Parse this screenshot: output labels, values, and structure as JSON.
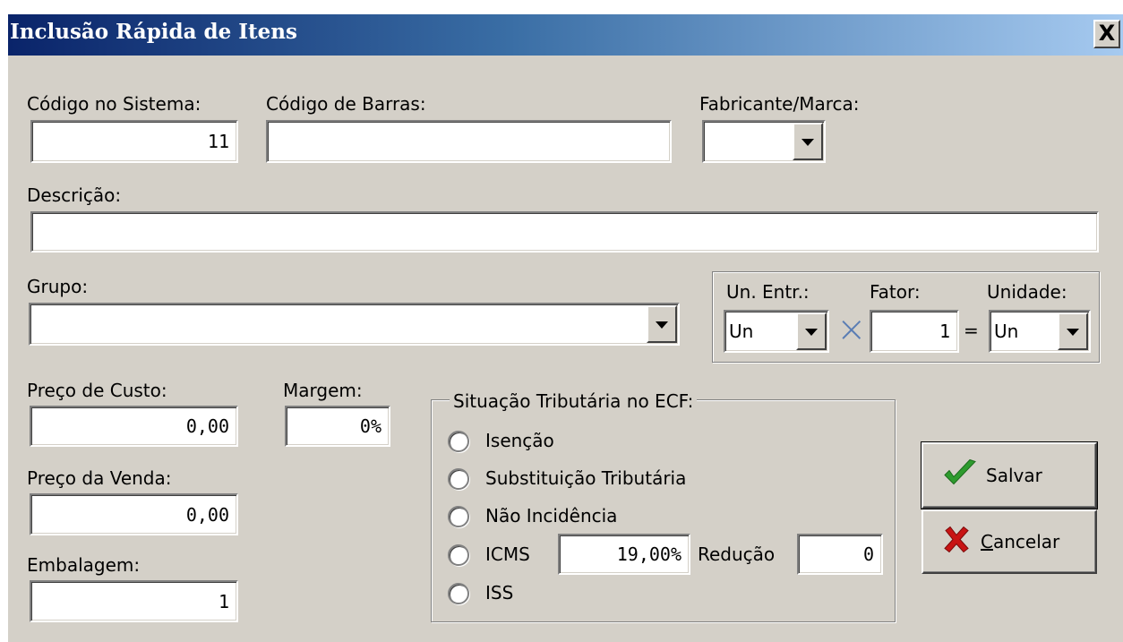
{
  "window": {
    "title": "Inclusão Rápida de Itens",
    "close_label": "X"
  },
  "codigo_sistema": {
    "label": "Código no Sistema:",
    "value": "11"
  },
  "codigo_barras": {
    "label": "Código de Barras:",
    "value": ""
  },
  "fabricante": {
    "label": "Fabricante/Marca:",
    "value": ""
  },
  "descricao": {
    "label": "Descrição:",
    "value": ""
  },
  "grupo": {
    "label": "Grupo:",
    "value": ""
  },
  "unidades": {
    "un_entr_label": "Un. Entr.:",
    "un_entr_value": "Un",
    "times_symbol": "×",
    "fator_label": "Fator:",
    "fator_value": "1",
    "equals_symbol": "=",
    "unidade_label": "Unidade:",
    "unidade_value": "Un"
  },
  "preco_custo": {
    "label": "Preço de Custo:",
    "value": "0,00"
  },
  "margem": {
    "label": "Margem:",
    "value": "0%"
  },
  "preco_venda": {
    "label": "Preço da Venda:",
    "value": "0,00"
  },
  "embalagem": {
    "label": "Embalagem:",
    "value": "1"
  },
  "situacao": {
    "legend": "Situação Tributária no ECF:",
    "options": [
      "Isenção",
      "Substituição Tributária",
      "Não Incidência",
      "ICMS",
      "ISS"
    ],
    "icms_value": "19,00%",
    "reducao_label": "Redução",
    "reducao_value": "0"
  },
  "buttons": {
    "salvar": "Salvar",
    "cancelar_first": "C",
    "cancelar_rest": "ancelar",
    "salvar_icon": "check-icon",
    "cancelar_icon": "x-icon"
  },
  "colors": {
    "check": "#2e9b2e",
    "cancel": "#c81414",
    "titlebar_start": "#0a246a",
    "titlebar_end": "#a6caf0"
  }
}
